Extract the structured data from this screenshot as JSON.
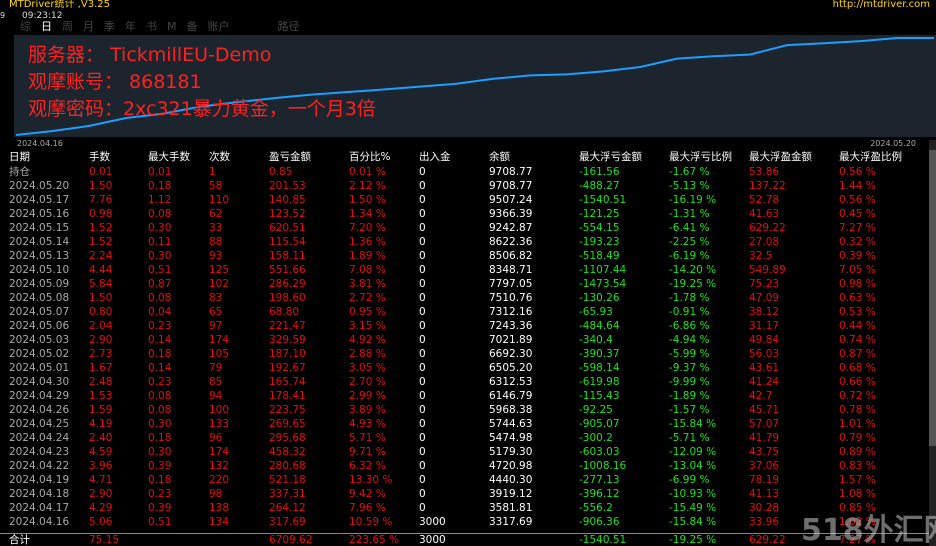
{
  "app": {
    "title": "MTDriver统计 ,V3.25",
    "url": "http://mtdriver.com",
    "time_left": "9",
    "time": "09:23:12"
  },
  "tabs": [
    "综",
    "日",
    "周",
    "月",
    "季",
    "年",
    "书",
    "M",
    "备",
    "账户",
    "路径"
  ],
  "active_tab": 1,
  "info": {
    "server_line": "服务器：  TickmillEU-Demo",
    "account_line": "观摩账号：  868181",
    "password_line": "观摩密码：2xc321暴力黄金，一个月3倍"
  },
  "chart": {
    "x_start": "2024.04.16",
    "x_end": "2024.05.20",
    "line_color": "#1a9fff",
    "values": [
      3317.69,
      3581.81,
      3919.12,
      4440.3,
      4720.98,
      5179.3,
      5474.98,
      5744.63,
      5968.38,
      6146.79,
      6312.53,
      6505.2,
      6692.3,
      7021.89,
      7243.36,
      7312.16,
      7510.76,
      7797.05,
      8348.71,
      8506.82,
      8622.36,
      9242.87,
      9366.39,
      9507.24,
      9708.77,
      9708.77
    ]
  },
  "table": {
    "headers": [
      "日期",
      "手数",
      "最大手数",
      "次数",
      "盈亏金额",
      "百分比%",
      "出入金",
      "余额",
      "最大浮亏金额",
      "最大浮亏比例",
      "最大浮盈金额",
      "最大浮盈比例"
    ],
    "rows": [
      [
        "持仓",
        "0.01",
        "0.01",
        "1",
        "0.85",
        "0.01 %",
        "0",
        "9708.77",
        "-161.56",
        "-1.67 %",
        "53.86",
        "0.56 %"
      ],
      [
        "2024.05.20",
        "1.50",
        "0.18",
        "58",
        "201.53",
        "2.12 %",
        "0",
        "9708.77",
        "-488.27",
        "-5.13 %",
        "137.22",
        "1.44 %"
      ],
      [
        "2024.05.17",
        "7.76",
        "1.12",
        "110",
        "140.85",
        "1.50 %",
        "0",
        "9507.24",
        "-1540.51",
        "-16.19 %",
        "52.78",
        "0.56 %"
      ],
      [
        "2024.05.16",
        "0.98",
        "0.08",
        "62",
        "123.52",
        "1.34 %",
        "0",
        "9366.39",
        "-121.25",
        "-1.31 %",
        "41.63",
        "0.45 %"
      ],
      [
        "2024.05.15",
        "1.52",
        "0.30",
        "33",
        "620.51",
        "7.20 %",
        "0",
        "9242.87",
        "-554.15",
        "-6.41 %",
        "629.22",
        "7.27 %"
      ],
      [
        "2024.05.14",
        "1.52",
        "0.11",
        "88",
        "115.54",
        "1.36 %",
        "0",
        "8622.36",
        "-193.23",
        "-2.25 %",
        "27.08",
        "0.32 %"
      ],
      [
        "2024.05.13",
        "2.24",
        "0.30",
        "93",
        "158.11",
        "1.89 %",
        "0",
        "8506.82",
        "-518.49",
        "-6.19 %",
        "32.5",
        "0.39 %"
      ],
      [
        "2024.05.10",
        "4.44",
        "0.51",
        "125",
        "551.66",
        "7.08 %",
        "0",
        "8348.71",
        "-1107.44",
        "-14.20 %",
        "549.89",
        "7.05 %"
      ],
      [
        "2024.05.09",
        "5.84",
        "0.87",
        "102",
        "286.29",
        "3.81 %",
        "0",
        "7797.05",
        "-1473.54",
        "-19.25 %",
        "75.23",
        "0.98 %"
      ],
      [
        "2024.05.08",
        "1.50",
        "0.08",
        "83",
        "198.60",
        "2.72 %",
        "0",
        "7510.76",
        "-130.26",
        "-1.78 %",
        "47.09",
        "0.63 %"
      ],
      [
        "2024.05.07",
        "0.80",
        "0.04",
        "65",
        "68.80",
        "0.95 %",
        "0",
        "7312.16",
        "-65.93",
        "-0.91 %",
        "38.12",
        "0.53 %"
      ],
      [
        "2024.05.06",
        "2.04",
        "0.23",
        "97",
        "221.47",
        "3.15 %",
        "0",
        "7243.36",
        "-484.64",
        "-6.86 %",
        "31.17",
        "0.44 %"
      ],
      [
        "2024.05.03",
        "2.90",
        "0.14",
        "174",
        "329.59",
        "4.92 %",
        "0",
        "7021.89",
        "-340.4",
        "-4.94 %",
        "49.84",
        "0.74 %"
      ],
      [
        "2024.05.02",
        "2.73",
        "0.18",
        "105",
        "187.10",
        "2.88 %",
        "0",
        "6692.30",
        "-390.37",
        "-5.99 %",
        "56.03",
        "0.87 %"
      ],
      [
        "2024.05.01",
        "1.67",
        "0.14",
        "79",
        "192.67",
        "3.05 %",
        "0",
        "6505.20",
        "-598.14",
        "-9.37 %",
        "43.61",
        "0.68 %"
      ],
      [
        "2024.04.30",
        "2.48",
        "0.23",
        "85",
        "165.74",
        "2.70 %",
        "0",
        "6312.53",
        "-619.98",
        "-9.99 %",
        "41.24",
        "0.66 %"
      ],
      [
        "2024.04.29",
        "1.53",
        "0.08",
        "94",
        "178.41",
        "2.99 %",
        "0",
        "6146.79",
        "-115.43",
        "-1.89 %",
        "42.7",
        "0.72 %"
      ],
      [
        "2024.04.26",
        "1.59",
        "0.08",
        "100",
        "223.75",
        "3.89 %",
        "0",
        "5968.38",
        "-92.25",
        "-1.57 %",
        "45.71",
        "0.78 %"
      ],
      [
        "2024.04.25",
        "4.19",
        "0.30",
        "133",
        "269.65",
        "4.93 %",
        "0",
        "5744.63",
        "-905.07",
        "-15.84 %",
        "57.07",
        "1.01 %"
      ],
      [
        "2024.04.24",
        "2.40",
        "0.18",
        "96",
        "295.68",
        "5.71 %",
        "0",
        "5474.98",
        "-300.2",
        "-5.71 %",
        "41.79",
        "0.79 %"
      ],
      [
        "2024.04.23",
        "4.59",
        "0.30",
        "174",
        "458.32",
        "9.71 %",
        "0",
        "5179.30",
        "-603.03",
        "-12.09 %",
        "43.75",
        "0.89 %"
      ],
      [
        "2024.04.22",
        "3.96",
        "0.39",
        "132",
        "280.68",
        "6.32 %",
        "0",
        "4720.98",
        "-1008.16",
        "-13.04 %",
        "37.06",
        "0.83 %"
      ],
      [
        "2024.04.19",
        "4.71",
        "0.18",
        "220",
        "521.18",
        "13.30 %",
        "0",
        "4440.30",
        "-277.13",
        "-6.99 %",
        "78.19",
        "1.57 %"
      ],
      [
        "2024.04.18",
        "2.90",
        "0.23",
        "98",
        "337.31",
        "9.42 %",
        "0",
        "3919.12",
        "-396.12",
        "-10.93 %",
        "41.13",
        "1.08 %"
      ],
      [
        "2024.04.17",
        "4.29",
        "0.39",
        "138",
        "264.12",
        "7.96 %",
        "0",
        "3581.81",
        "-556.2",
        "-15.49 %",
        "30.28",
        "0.85 %"
      ],
      [
        "2024.04.16",
        "5.06",
        "0.51",
        "134",
        "317.69",
        "10.59 %",
        "3000",
        "3317.69",
        "-906.36",
        "-15.84 %",
        "33.96",
        "1.02 %"
      ]
    ],
    "total": [
      "合计",
      "75.15",
      "",
      "",
      "6709.62",
      "223.65 %",
      "3000",
      "",
      "-1540.51",
      "-19.25 %",
      "629.22",
      "7.27 %"
    ]
  },
  "watermark": "518外汇网",
  "colors": {
    "profit": "#e01010",
    "loss": "#20e020",
    "info": "#ff2020",
    "title": "#ffd700"
  }
}
